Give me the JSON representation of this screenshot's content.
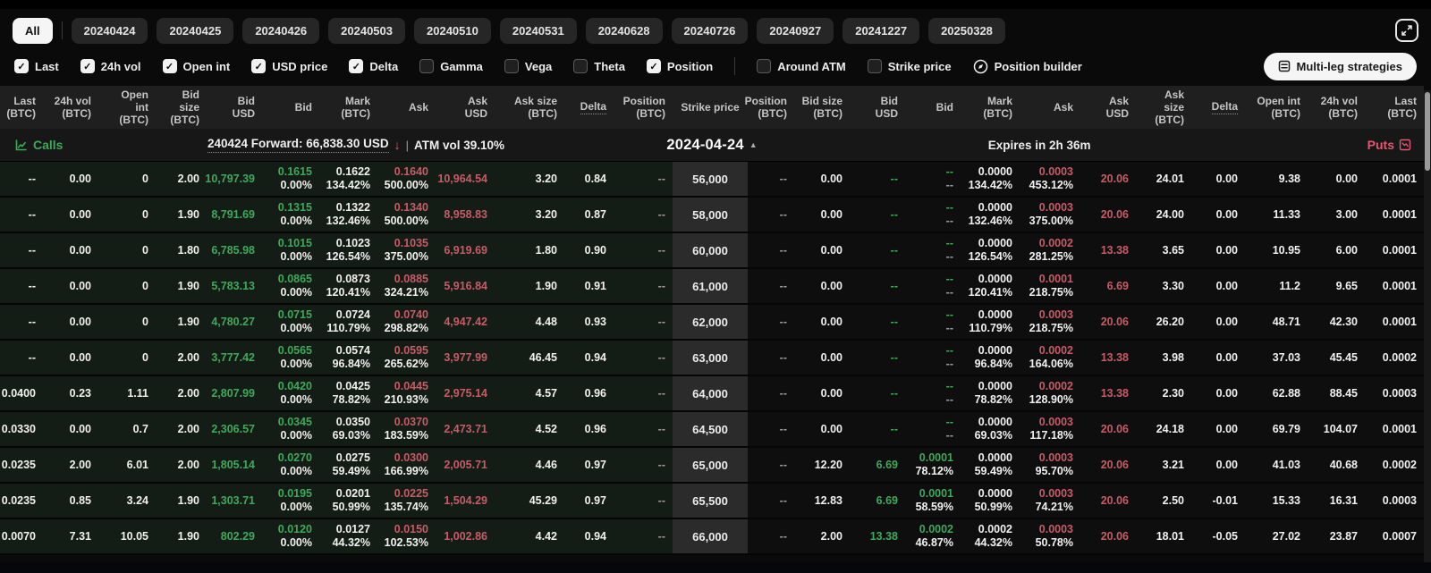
{
  "colors": {
    "green": "#3ea95c",
    "red": "#c75b69"
  },
  "toolbar": {
    "tabs": [
      {
        "label": "All",
        "active": true
      },
      {
        "label": "20240424",
        "active": false
      },
      {
        "label": "20240425",
        "active": false
      },
      {
        "label": "20240426",
        "active": false
      },
      {
        "label": "20240503",
        "active": false
      },
      {
        "label": "20240510",
        "active": false
      },
      {
        "label": "20240531",
        "active": false
      },
      {
        "label": "20240628",
        "active": false
      },
      {
        "label": "20240726",
        "active": false
      },
      {
        "label": "20240927",
        "active": false
      },
      {
        "label": "20241227",
        "active": false
      },
      {
        "label": "20250328",
        "active": false
      }
    ]
  },
  "filters": {
    "checkboxes": [
      {
        "label": "Last",
        "checked": true
      },
      {
        "label": "24h vol",
        "checked": true
      },
      {
        "label": "Open int",
        "checked": true
      },
      {
        "label": "USD price",
        "checked": true
      },
      {
        "label": "Delta",
        "checked": true
      },
      {
        "label": "Gamma",
        "checked": false
      },
      {
        "label": "Vega",
        "checked": false
      },
      {
        "label": "Theta",
        "checked": false
      },
      {
        "label": "Position",
        "checked": true
      },
      {
        "label": "Around ATM",
        "checked": false,
        "divider_before": true
      },
      {
        "label": "Strike price",
        "checked": false
      }
    ],
    "position_builder_label": "Position builder",
    "multileg_label": "Multi-leg strategies"
  },
  "table": {
    "calls_headers": [
      {
        "l1": "Last",
        "l2": "(BTC)"
      },
      {
        "l1": "24h vol",
        "l2": "(BTC)"
      },
      {
        "l1": "Open int",
        "l2": "(BTC)"
      },
      {
        "l1": "Bid size",
        "l2": "(BTC)"
      },
      {
        "l1": "Bid",
        "l2": "USD"
      },
      {
        "l1": "Bid",
        "l2": ""
      },
      {
        "l1": "Mark",
        "l2": "(BTC)"
      },
      {
        "l1": "Ask",
        "l2": ""
      },
      {
        "l1": "Ask",
        "l2": "USD"
      },
      {
        "l1": "Ask size",
        "l2": "(BTC)"
      },
      {
        "l1": "Delta",
        "l2": "",
        "dotted": true
      },
      {
        "l1": "Position",
        "l2": "(BTC)"
      }
    ],
    "strike_header": {
      "l1": "Strike price",
      "l2": ""
    },
    "puts_headers": [
      {
        "l1": "Position",
        "l2": "(BTC)"
      },
      {
        "l1": "Bid size",
        "l2": "(BTC)"
      },
      {
        "l1": "Bid",
        "l2": "USD"
      },
      {
        "l1": "Bid",
        "l2": ""
      },
      {
        "l1": "Mark",
        "l2": "(BTC)"
      },
      {
        "l1": "Ask",
        "l2": ""
      },
      {
        "l1": "Ask",
        "l2": "USD"
      },
      {
        "l1": "Ask size",
        "l2": "(BTC)"
      },
      {
        "l1": "Delta",
        "l2": "",
        "dotted": true
      },
      {
        "l1": "Open int",
        "l2": "(BTC)"
      },
      {
        "l1": "24h vol",
        "l2": "(BTC)"
      },
      {
        "l1": "Last",
        "l2": "(BTC)"
      }
    ]
  },
  "expiry_bar": {
    "calls_label": "Calls",
    "forward_text": "240424 Forward: 66,838.30 USD",
    "forward_arrow": "↓",
    "separator": "|",
    "atm_text": "ATM vol 39.10%",
    "date": "2024-04-24",
    "date_caret": "▲",
    "expires": "Expires in 2h 36m",
    "puts_label": "Puts"
  },
  "rows": [
    {
      "strike": "56,000",
      "calls": {
        "last": "--",
        "vol": "0.00",
        "oi": "0",
        "bid_size": "2.00",
        "bid_usd": "10,797.39",
        "bid": "0.1615",
        "bid_pct": "0.00%",
        "mark": "0.1622",
        "mark_pct": "134.42%",
        "ask": "0.1640",
        "ask_pct": "500.00%",
        "ask_usd": "10,964.54",
        "ask_size": "3.20",
        "delta": "0.84",
        "position": "--"
      },
      "puts": {
        "position": "--",
        "bid_size": "0.00",
        "bid_usd": "--",
        "bid": "--",
        "bid_pct": "--",
        "mark": "0.0000",
        "mark_pct": "134.42%",
        "ask": "0.0003",
        "ask_pct": "453.12%",
        "ask_usd": "20.06",
        "ask_size": "24.01",
        "delta": "0.00",
        "oi": "9.38",
        "vol": "0.00",
        "last": "0.0001"
      }
    },
    {
      "strike": "58,000",
      "calls": {
        "last": "--",
        "vol": "0.00",
        "oi": "0",
        "bid_size": "1.90",
        "bid_usd": "8,791.69",
        "bid": "0.1315",
        "bid_pct": "0.00%",
        "mark": "0.1322",
        "mark_pct": "132.46%",
        "ask": "0.1340",
        "ask_pct": "500.00%",
        "ask_usd": "8,958.83",
        "ask_size": "3.20",
        "delta": "0.87",
        "position": "--"
      },
      "puts": {
        "position": "--",
        "bid_size": "0.00",
        "bid_usd": "--",
        "bid": "--",
        "bid_pct": "--",
        "mark": "0.0000",
        "mark_pct": "132.46%",
        "ask": "0.0003",
        "ask_pct": "375.00%",
        "ask_usd": "20.06",
        "ask_size": "24.00",
        "delta": "0.00",
        "oi": "11.33",
        "vol": "3.00",
        "last": "0.0001"
      }
    },
    {
      "strike": "60,000",
      "calls": {
        "last": "--",
        "vol": "0.00",
        "oi": "0",
        "bid_size": "1.80",
        "bid_usd": "6,785.98",
        "bid": "0.1015",
        "bid_pct": "0.00%",
        "mark": "0.1023",
        "mark_pct": "126.54%",
        "ask": "0.1035",
        "ask_pct": "375.00%",
        "ask_usd": "6,919.69",
        "ask_size": "1.80",
        "delta": "0.90",
        "position": "--"
      },
      "puts": {
        "position": "--",
        "bid_size": "0.00",
        "bid_usd": "--",
        "bid": "--",
        "bid_pct": "--",
        "mark": "0.0000",
        "mark_pct": "126.54%",
        "ask": "0.0002",
        "ask_pct": "281.25%",
        "ask_usd": "13.38",
        "ask_size": "3.65",
        "delta": "0.00",
        "oi": "10.95",
        "vol": "6.00",
        "last": "0.0001"
      }
    },
    {
      "strike": "61,000",
      "calls": {
        "last": "--",
        "vol": "0.00",
        "oi": "0",
        "bid_size": "1.90",
        "bid_usd": "5,783.13",
        "bid": "0.0865",
        "bid_pct": "0.00%",
        "mark": "0.0873",
        "mark_pct": "120.41%",
        "ask": "0.0885",
        "ask_pct": "324.21%",
        "ask_usd": "5,916.84",
        "ask_size": "1.90",
        "delta": "0.91",
        "position": "--"
      },
      "puts": {
        "position": "--",
        "bid_size": "0.00",
        "bid_usd": "--",
        "bid": "--",
        "bid_pct": "--",
        "mark": "0.0000",
        "mark_pct": "120.41%",
        "ask": "0.0001",
        "ask_pct": "218.75%",
        "ask_usd": "6.69",
        "ask_size": "3.30",
        "delta": "0.00",
        "oi": "11.2",
        "vol": "9.65",
        "last": "0.0001"
      }
    },
    {
      "strike": "62,000",
      "calls": {
        "last": "--",
        "vol": "0.00",
        "oi": "0",
        "bid_size": "1.90",
        "bid_usd": "4,780.27",
        "bid": "0.0715",
        "bid_pct": "0.00%",
        "mark": "0.0724",
        "mark_pct": "110.79%",
        "ask": "0.0740",
        "ask_pct": "298.82%",
        "ask_usd": "4,947.42",
        "ask_size": "4.48",
        "delta": "0.93",
        "position": "--"
      },
      "puts": {
        "position": "--",
        "bid_size": "0.00",
        "bid_usd": "--",
        "bid": "--",
        "bid_pct": "--",
        "mark": "0.0000",
        "mark_pct": "110.79%",
        "ask": "0.0003",
        "ask_pct": "218.75%",
        "ask_usd": "20.06",
        "ask_size": "26.20",
        "delta": "0.00",
        "oi": "48.71",
        "vol": "42.30",
        "last": "0.0001"
      }
    },
    {
      "strike": "63,000",
      "calls": {
        "last": "--",
        "vol": "0.00",
        "oi": "0",
        "bid_size": "2.00",
        "bid_usd": "3,777.42",
        "bid": "0.0565",
        "bid_pct": "0.00%",
        "mark": "0.0574",
        "mark_pct": "96.84%",
        "ask": "0.0595",
        "ask_pct": "265.62%",
        "ask_usd": "3,977.99",
        "ask_size": "46.45",
        "delta": "0.94",
        "position": "--"
      },
      "puts": {
        "position": "--",
        "bid_size": "0.00",
        "bid_usd": "--",
        "bid": "--",
        "bid_pct": "--",
        "mark": "0.0000",
        "mark_pct": "96.84%",
        "ask": "0.0002",
        "ask_pct": "164.06%",
        "ask_usd": "13.38",
        "ask_size": "3.98",
        "delta": "0.00",
        "oi": "37.03",
        "vol": "45.45",
        "last": "0.0002"
      }
    },
    {
      "strike": "64,000",
      "calls": {
        "last": "0.0400",
        "vol": "0.23",
        "oi": "1.11",
        "bid_size": "2.00",
        "bid_usd": "2,807.99",
        "bid": "0.0420",
        "bid_pct": "0.00%",
        "mark": "0.0425",
        "mark_pct": "78.82%",
        "ask": "0.0445",
        "ask_pct": "210.93%",
        "ask_usd": "2,975.14",
        "ask_size": "4.57",
        "delta": "0.96",
        "position": "--"
      },
      "puts": {
        "position": "--",
        "bid_size": "0.00",
        "bid_usd": "--",
        "bid": "--",
        "bid_pct": "--",
        "mark": "0.0000",
        "mark_pct": "78.82%",
        "ask": "0.0002",
        "ask_pct": "128.90%",
        "ask_usd": "13.38",
        "ask_size": "2.30",
        "delta": "0.00",
        "oi": "62.88",
        "vol": "88.45",
        "last": "0.0003"
      }
    },
    {
      "strike": "64,500",
      "calls": {
        "last": "0.0330",
        "vol": "0.00",
        "oi": "0.7",
        "bid_size": "2.00",
        "bid_usd": "2,306.57",
        "bid": "0.0345",
        "bid_pct": "0.00%",
        "mark": "0.0350",
        "mark_pct": "69.03%",
        "ask": "0.0370",
        "ask_pct": "183.59%",
        "ask_usd": "2,473.71",
        "ask_size": "4.52",
        "delta": "0.96",
        "position": "--"
      },
      "puts": {
        "position": "--",
        "bid_size": "0.00",
        "bid_usd": "--",
        "bid": "--",
        "bid_pct": "--",
        "mark": "0.0000",
        "mark_pct": "69.03%",
        "ask": "0.0003",
        "ask_pct": "117.18%",
        "ask_usd": "20.06",
        "ask_size": "24.18",
        "delta": "0.00",
        "oi": "69.79",
        "vol": "104.07",
        "last": "0.0001"
      }
    },
    {
      "strike": "65,000",
      "calls": {
        "last": "0.0235",
        "vol": "2.00",
        "oi": "6.01",
        "bid_size": "2.00",
        "bid_usd": "1,805.14",
        "bid": "0.0270",
        "bid_pct": "0.00%",
        "mark": "0.0275",
        "mark_pct": "59.49%",
        "ask": "0.0300",
        "ask_pct": "166.99%",
        "ask_usd": "2,005.71",
        "ask_size": "4.46",
        "delta": "0.97",
        "position": "--"
      },
      "puts": {
        "position": "--",
        "bid_size": "12.20",
        "bid_usd": "6.69",
        "bid": "0.0001",
        "bid_pct": "78.12%",
        "mark": "0.0000",
        "mark_pct": "59.49%",
        "ask": "0.0003",
        "ask_pct": "95.70%",
        "ask_usd": "20.06",
        "ask_size": "3.21",
        "delta": "0.00",
        "oi": "41.03",
        "vol": "40.68",
        "last": "0.0002"
      }
    },
    {
      "strike": "65,500",
      "calls": {
        "last": "0.0235",
        "vol": "0.85",
        "oi": "3.24",
        "bid_size": "1.90",
        "bid_usd": "1,303.71",
        "bid": "0.0195",
        "bid_pct": "0.00%",
        "mark": "0.0201",
        "mark_pct": "50.99%",
        "ask": "0.0225",
        "ask_pct": "135.74%",
        "ask_usd": "1,504.29",
        "ask_size": "45.29",
        "delta": "0.97",
        "position": "--"
      },
      "puts": {
        "position": "--",
        "bid_size": "12.83",
        "bid_usd": "6.69",
        "bid": "0.0001",
        "bid_pct": "58.59%",
        "mark": "0.0000",
        "mark_pct": "50.99%",
        "ask": "0.0003",
        "ask_pct": "74.21%",
        "ask_usd": "20.06",
        "ask_size": "2.50",
        "delta": "-0.01",
        "oi": "15.33",
        "vol": "16.31",
        "last": "0.0003"
      }
    },
    {
      "strike": "66,000",
      "calls": {
        "last": "0.0070",
        "vol": "7.31",
        "oi": "10.05",
        "bid_size": "1.90",
        "bid_usd": "802.29",
        "bid": "0.0120",
        "bid_pct": "0.00%",
        "mark": "0.0127",
        "mark_pct": "44.32%",
        "ask": "0.0150",
        "ask_pct": "102.53%",
        "ask_usd": "1,002.86",
        "ask_size": "4.42",
        "delta": "0.94",
        "position": "--"
      },
      "puts": {
        "position": "--",
        "bid_size": "2.00",
        "bid_usd": "13.38",
        "bid": "0.0002",
        "bid_pct": "46.87%",
        "mark": "0.0002",
        "mark_pct": "44.32%",
        "ask": "0.0003",
        "ask_pct": "50.78%",
        "ask_usd": "20.06",
        "ask_size": "18.01",
        "delta": "-0.05",
        "oi": "27.02",
        "vol": "23.87",
        "last": "0.0007"
      }
    }
  ]
}
